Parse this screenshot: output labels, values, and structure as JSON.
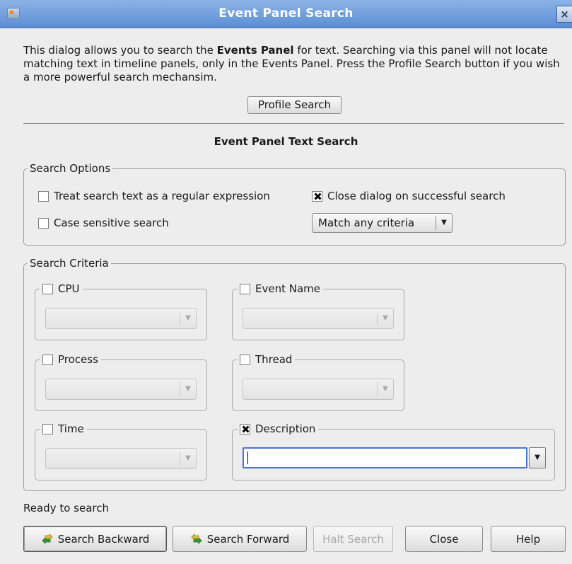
{
  "window": {
    "title": "Event Panel Search",
    "close_label": "×"
  },
  "intro": {
    "part1": "This dialog allows you to search the ",
    "bold": "Events Panel",
    "part2": " for text. Searching via this panel will not locate matching text in timeline panels, only in the Events Panel. Press the Profile Search button if you wish a more powerful search mechansim."
  },
  "profile_search_label": "Profile Search",
  "section_title": "Event Panel Text Search",
  "search_options": {
    "legend": "Search Options",
    "regex": {
      "label": "Treat search text as a regular expression",
      "checked": false
    },
    "close_on_success": {
      "label": "Close dialog on successful search",
      "checked": true
    },
    "case_sensitive": {
      "label": "Case sensitive search",
      "checked": false
    },
    "match_mode": {
      "selected": "Match any criteria"
    }
  },
  "search_criteria": {
    "legend": "Search Criteria",
    "cpu": {
      "label": "CPU",
      "checked": false
    },
    "event_name": {
      "label": "Event Name",
      "checked": false
    },
    "process": {
      "label": "Process",
      "checked": false
    },
    "thread": {
      "label": "Thread",
      "checked": false
    },
    "time": {
      "label": "Time",
      "checked": false
    },
    "description": {
      "label": "Description",
      "checked": true,
      "value": ""
    }
  },
  "status_text": "Ready to search",
  "buttons": {
    "search_backward": "Search Backward",
    "search_forward": "Search Forward",
    "halt_search": "Halt Search",
    "close": "Close",
    "help": "Help"
  },
  "icons": {
    "app": "app-icon",
    "search_backward": "search-backward-icon",
    "search_forward": "search-forward-icon"
  },
  "colors": {
    "titlebar": "#5b8ed4",
    "focus_border": "#4a78c8"
  }
}
